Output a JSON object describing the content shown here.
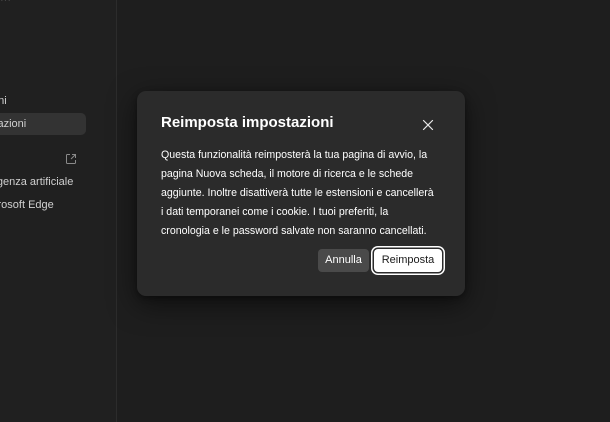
{
  "sidebar": {
    "top_fragment": "···",
    "items": [
      {
        "label": "oni",
        "selected": false
      },
      {
        "label": "zazioni",
        "selected": true
      },
      {
        "label": "ligenza artificiale",
        "selected": false
      },
      {
        "label": "crosoft Edge",
        "selected": false
      }
    ],
    "external_link_icon": "external-link-icon"
  },
  "dialog": {
    "title": "Reimposta impostazioni",
    "body_lines": [
      "Questa funzionalità reimposterà la tua pagina di avvio, la",
      "pagina Nuova scheda, il motore di ricerca e le schede",
      "aggiunte. Inoltre disattiverà tutte le estensioni e cancellerà",
      "i dati temporanei come i cookie. I tuoi preferiti, la",
      "cronologia e le password salvate non saranno cancellati."
    ],
    "cancel_label": "Annulla",
    "reset_label": "Reimposta",
    "close_icon": "close-icon"
  },
  "colors": {
    "background": "#1f1f1f",
    "dialog_bg": "#2b2b2b",
    "cancel_bg": "#4a4a4a",
    "primary_bg": "#ffffff"
  }
}
